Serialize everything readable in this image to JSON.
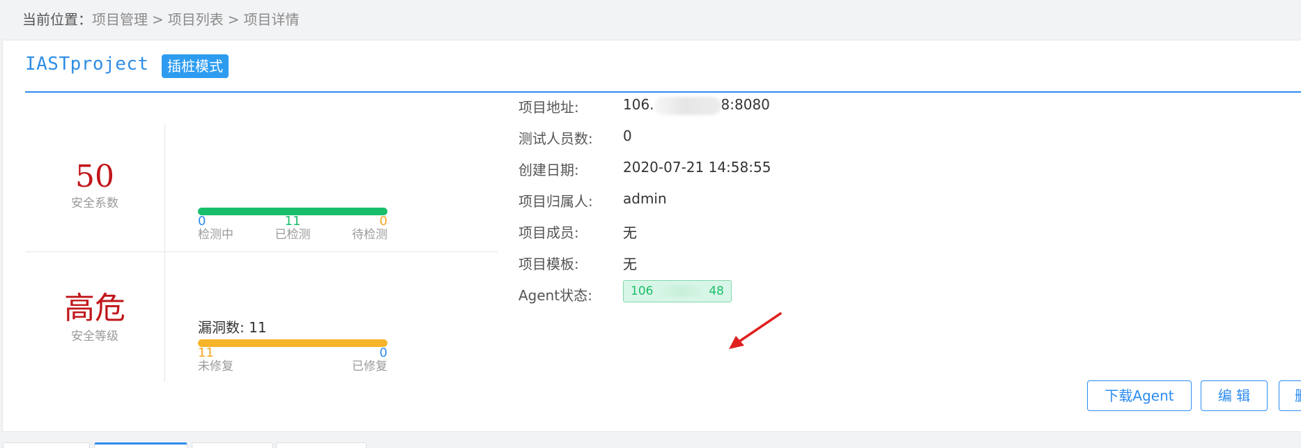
{
  "breadcrumb": {
    "prefix": "当前位置：",
    "items": [
      "项目管理",
      "项目列表",
      "项目详情"
    ],
    "separator": ">"
  },
  "project": {
    "name": "IASTproject",
    "mode_badge": "插桩模式"
  },
  "stats": {
    "security_score": {
      "value": "50",
      "label": "安全系数"
    },
    "detection": {
      "in_progress": {
        "value": "0",
        "label": "检测中"
      },
      "detected": {
        "value": "11",
        "label": "已检测"
      },
      "pending": {
        "value": "0",
        "label": "待检测"
      }
    },
    "security_level": {
      "value": "高危",
      "label": "安全等级"
    },
    "vulnerabilities": {
      "label": "漏洞数: 11",
      "unfixed": {
        "value": "11",
        "label": "未修复"
      },
      "fixed": {
        "value": "0",
        "label": "已修复"
      }
    }
  },
  "info": {
    "address": {
      "key": "项目地址:",
      "prefix": "106.",
      "suffix": "8:8080"
    },
    "testers": {
      "key": "测试人员数:",
      "value": "0"
    },
    "created": {
      "key": "创建日期:",
      "value": "2020-07-21 14:58:55"
    },
    "owner": {
      "key": "项目归属人:",
      "value": "admin"
    },
    "members": {
      "key": "项目成员:",
      "value": "无"
    },
    "template": {
      "key": "项目模板:",
      "value": "无"
    },
    "agent_status": {
      "key": "Agent状态:",
      "prefix": "106",
      "suffix": "48"
    }
  },
  "actions": {
    "download_agent": "下载Agent",
    "edit": "编 辑",
    "delete": "删"
  },
  "colors": {
    "accent": "#2d8cf0",
    "danger": "#c0161b",
    "success": "#19be6b",
    "warning": "#f6b42a"
  }
}
